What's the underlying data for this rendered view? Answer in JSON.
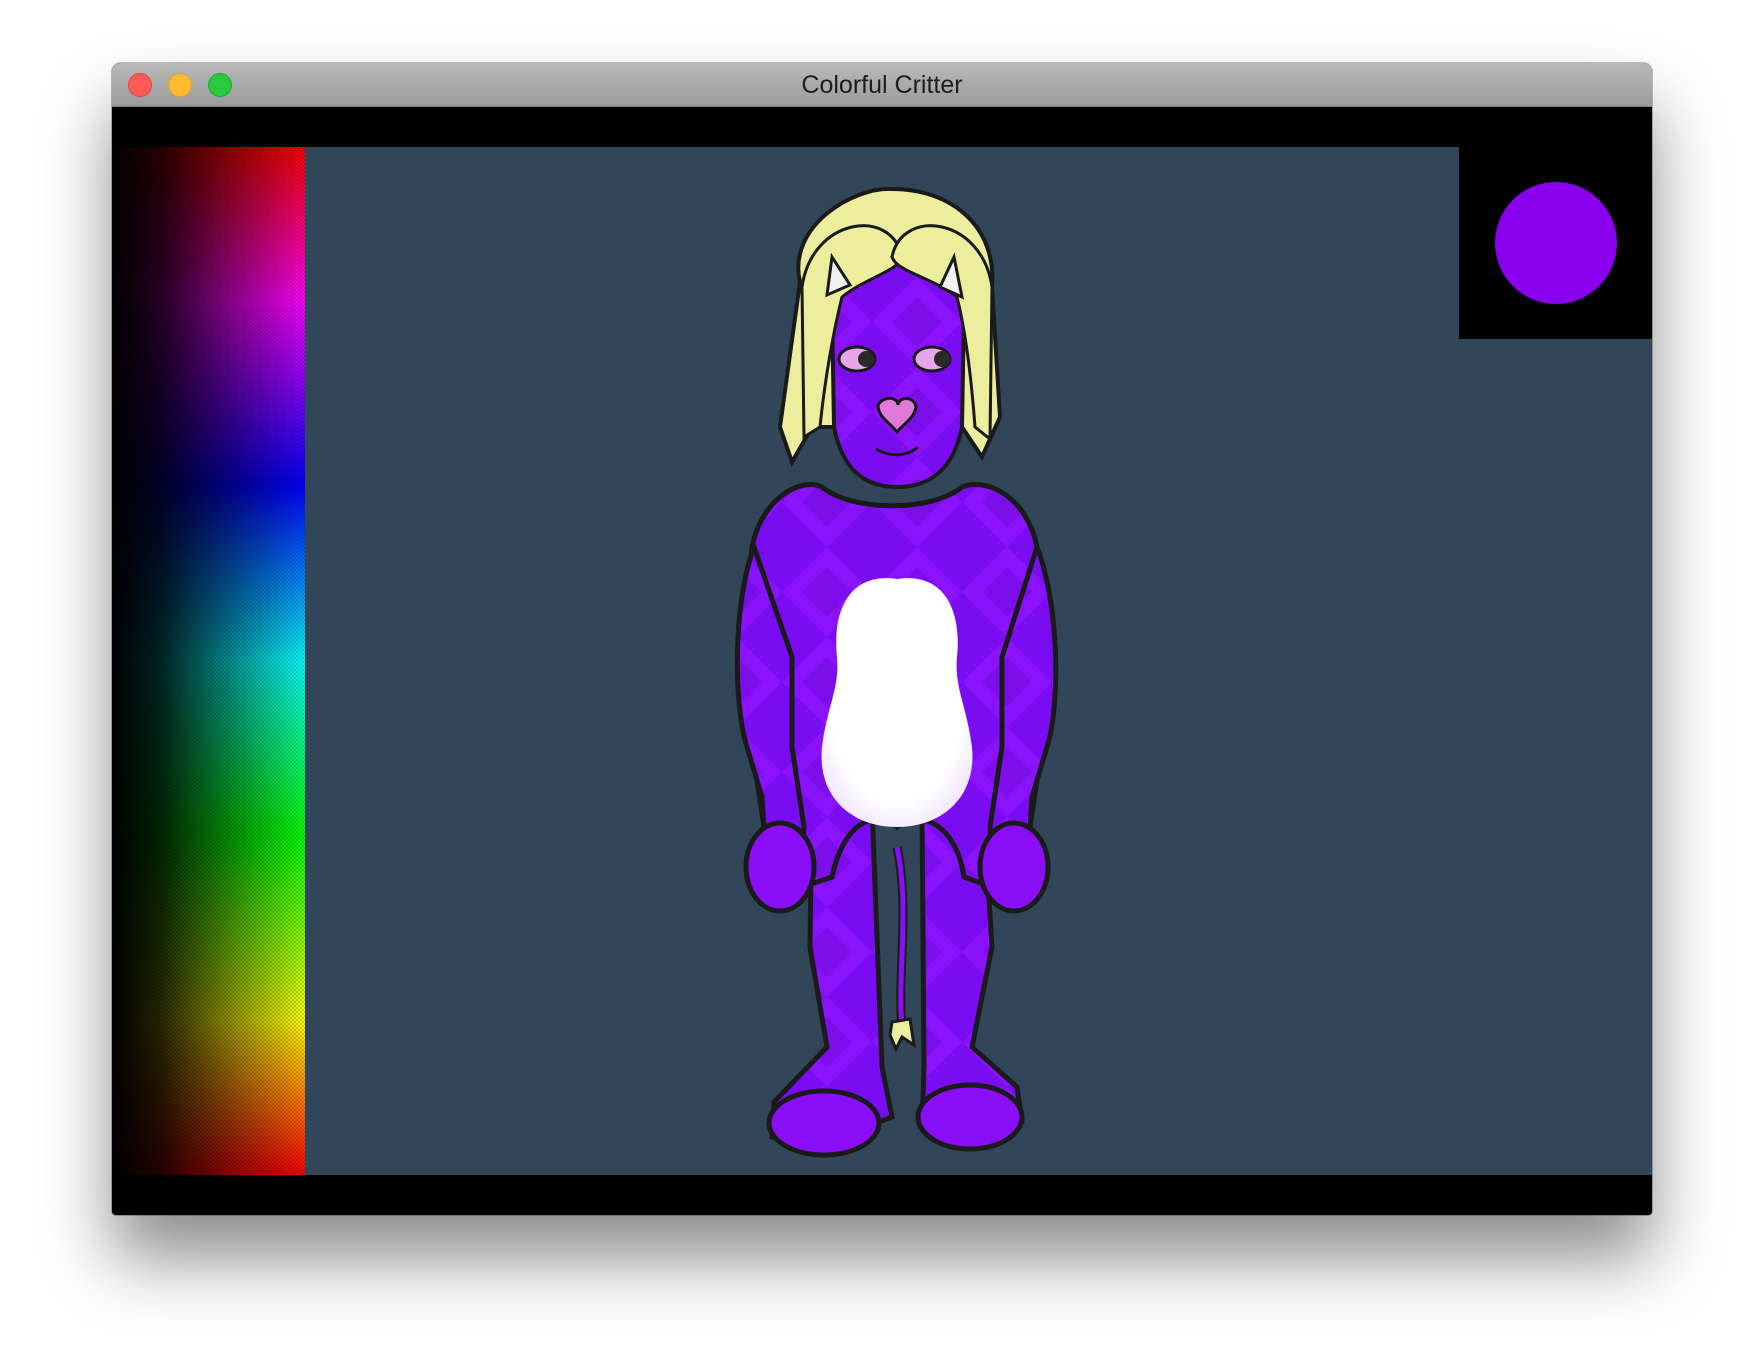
{
  "window": {
    "title": "Colorful Critter"
  },
  "selected_color": "#8a00ee",
  "colors": {
    "background": "#324659",
    "critter_body": "#7a0cf2",
    "critter_pattern": "#9a1aff",
    "belly": "#ffffff",
    "hair": "#ecee9e",
    "horns": "#f2f2f2",
    "nose": "#e07ad8"
  },
  "icons": {
    "close": "close-icon",
    "minimize": "minimize-icon",
    "maximize": "maximize-icon"
  }
}
